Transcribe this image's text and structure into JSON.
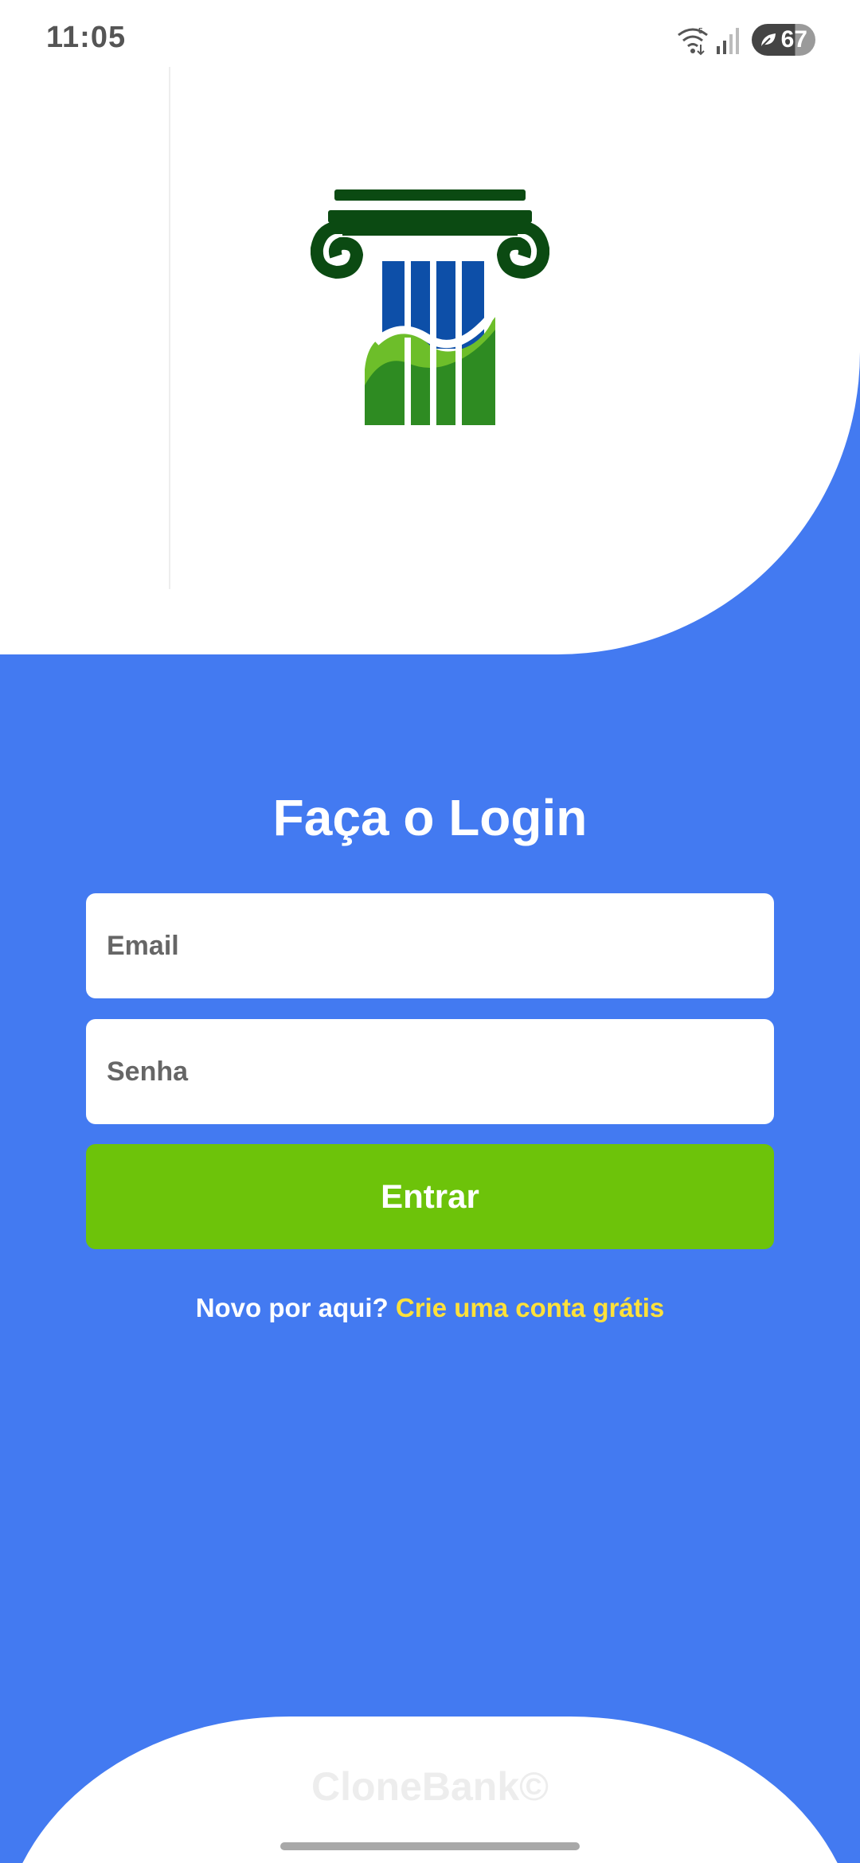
{
  "status_bar": {
    "time": "11:05",
    "wifi_badge": "5",
    "battery_level": "67",
    "icons": [
      "wifi-icon",
      "signal-icon",
      "battery-saver-leaf-icon"
    ]
  },
  "logo": {
    "icon": "bank-pillar-logo",
    "colors": {
      "dark_green": "#0B4A12",
      "blue": "#0D4FA8",
      "green": "#2E8B22",
      "light_green": "#6DBE2A"
    }
  },
  "login": {
    "title": "Faça o Login",
    "email": {
      "placeholder": "Email",
      "value": ""
    },
    "password": {
      "placeholder": "Senha",
      "value": ""
    },
    "submit_label": "Entrar",
    "signup_prompt": "Novo por aqui?",
    "signup_link": "Crie uma conta grátis"
  },
  "footer": {
    "brand": "CloneBank©"
  },
  "colors": {
    "background_blue": "#437AF1",
    "button_green": "#6DC30A",
    "link_yellow": "#FFE13A",
    "panel_white": "#FFFFFF"
  }
}
